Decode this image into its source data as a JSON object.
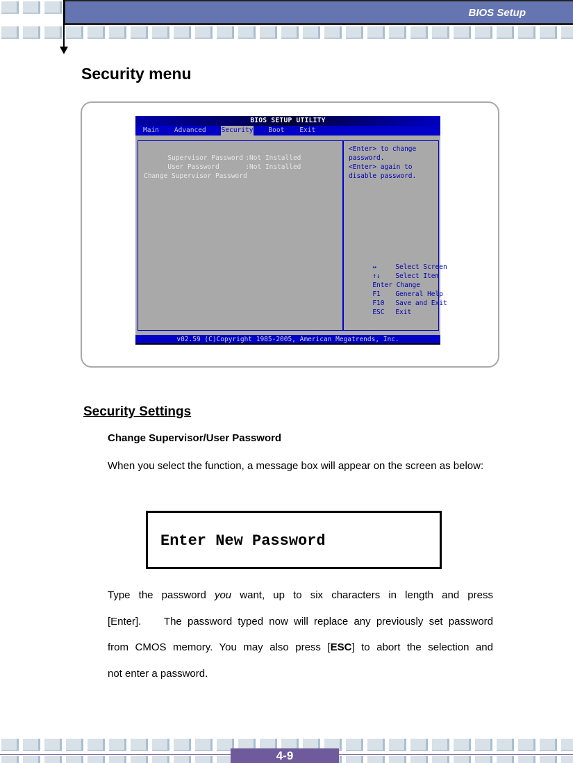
{
  "header": {
    "title": "BIOS Setup"
  },
  "section": {
    "title": "Security menu"
  },
  "bios_screen": {
    "title": "BIOS SETUP UTILITY",
    "menu": [
      {
        "label": "Main",
        "active": false
      },
      {
        "label": "Advanced",
        "active": false
      },
      {
        "label": "Security",
        "active": true
      },
      {
        "label": "Boot",
        "active": false
      },
      {
        "label": "Exit",
        "active": false
      }
    ],
    "settings": [
      {
        "label": "Supervisor Password",
        "value": ":Not Installed"
      },
      {
        "label": "User Password",
        "value": ":Not Installed"
      }
    ],
    "action": "Change Supervisor Password",
    "help": [
      "<Enter> to change",
      "password.",
      "<Enter> again to",
      "disable password."
    ],
    "keys": [
      {
        "key": "↔",
        "desc": "Select Screen",
        "icon": "left-right-arrow-icon"
      },
      {
        "key": "↑↓",
        "desc": "Select Item",
        "icon": "up-down-arrow-icon"
      },
      {
        "key": "Enter",
        "desc": "Change"
      },
      {
        "key": "F1",
        "desc": "General Help"
      },
      {
        "key": "F10",
        "desc": "Save and Exit"
      },
      {
        "key": "ESC",
        "desc": "Exit"
      }
    ],
    "footer": "v02.59 (C)Copyright 1985-2005, American Megatrends, Inc."
  },
  "content": {
    "subheading": "Security Settings",
    "item_heading": "Change Supervisor/User Password",
    "para1": "When you select the function, a message box will appear on the screen as below:",
    "message_box": "Enter New Password",
    "para2": {
      "l1_a": "Type the password ",
      "l1_em": "you",
      "l1_b": " want, up to six characters in length and press",
      "l2": "[Enter].    The password typed now will replace any previously set password",
      "l3_a": "from CMOS memory. You may also press [",
      "l3_strong": "ESC",
      "l3_b": "] to abort the selection and",
      "l4": "not enter a password."
    }
  },
  "footer": {
    "page_number": "4-9"
  },
  "colors": {
    "header_bar": "#6575b1",
    "page_box": "#6f5b9c",
    "bios_blue": "#0000c8",
    "bios_gray": "#a9a9a9"
  }
}
